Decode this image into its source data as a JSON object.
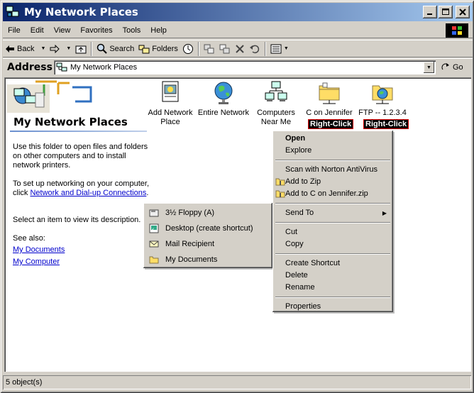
{
  "window": {
    "title": "My Network Places",
    "title_icon": "network-places-icon",
    "controls": {
      "minimize": "_",
      "maximize": "□",
      "close": "✕"
    }
  },
  "menubar": {
    "items": [
      "File",
      "Edit",
      "View",
      "Favorites",
      "Tools",
      "Help"
    ]
  },
  "toolbar": {
    "back_label": "Back",
    "search_label": "Search",
    "folders_label": "Folders"
  },
  "address": {
    "label": "Address",
    "value": "My Network Places",
    "go_label": "Go"
  },
  "panel": {
    "title": "My Network Places",
    "description": "Use this folder to open files and folders on other computers and to install network printers.",
    "setup_text": "To set up networking on your computer, click",
    "setup_link": "Network and Dial-up Connections",
    "setup_end": ".",
    "select_text": "Select an item to view its description.",
    "see_also_label": "See also:",
    "links": [
      "My Documents",
      "My Computer"
    ]
  },
  "items": [
    {
      "label": "Add Network Place",
      "icon": "add-network-place-icon"
    },
    {
      "label": "Entire Network",
      "icon": "globe-icon"
    },
    {
      "label": "Computers Near Me",
      "icon": "computers-icon"
    },
    {
      "label": "C on Jennifer",
      "icon": "network-folder-icon",
      "annotation": "Right-Click"
    },
    {
      "label": "FTP -- 1.2.3.4",
      "icon": "ftp-folder-icon",
      "annotation": "Right-Click"
    }
  ],
  "context_menu": {
    "open": "Open",
    "explore": "Explore",
    "scan": "Scan with Norton AntiVirus",
    "add_zip": "Add to Zip",
    "add_named_zip": "Add to C on Jennifer.zip",
    "send_to": "Send To",
    "cut": "Cut",
    "copy": "Copy",
    "create_shortcut": "Create Shortcut",
    "delete": "Delete",
    "rename": "Rename",
    "properties": "Properties"
  },
  "sendto_menu": {
    "items": [
      {
        "label": "3½ Floppy (A)",
        "icon": "floppy-icon"
      },
      {
        "label": "Desktop (create shortcut)",
        "icon": "desktop-icon"
      },
      {
        "label": "Mail Recipient",
        "icon": "mail-icon"
      },
      {
        "label": "My Documents",
        "icon": "folder-icon"
      }
    ]
  },
  "status": {
    "text": "5 object(s)"
  },
  "colors": {
    "title_start": "#0a246a",
    "title_end": "#a6caf0",
    "face": "#d4d0c8",
    "link": "#0000cc",
    "annotation_bg": "#000000",
    "annotation_border": "#dd0000"
  }
}
